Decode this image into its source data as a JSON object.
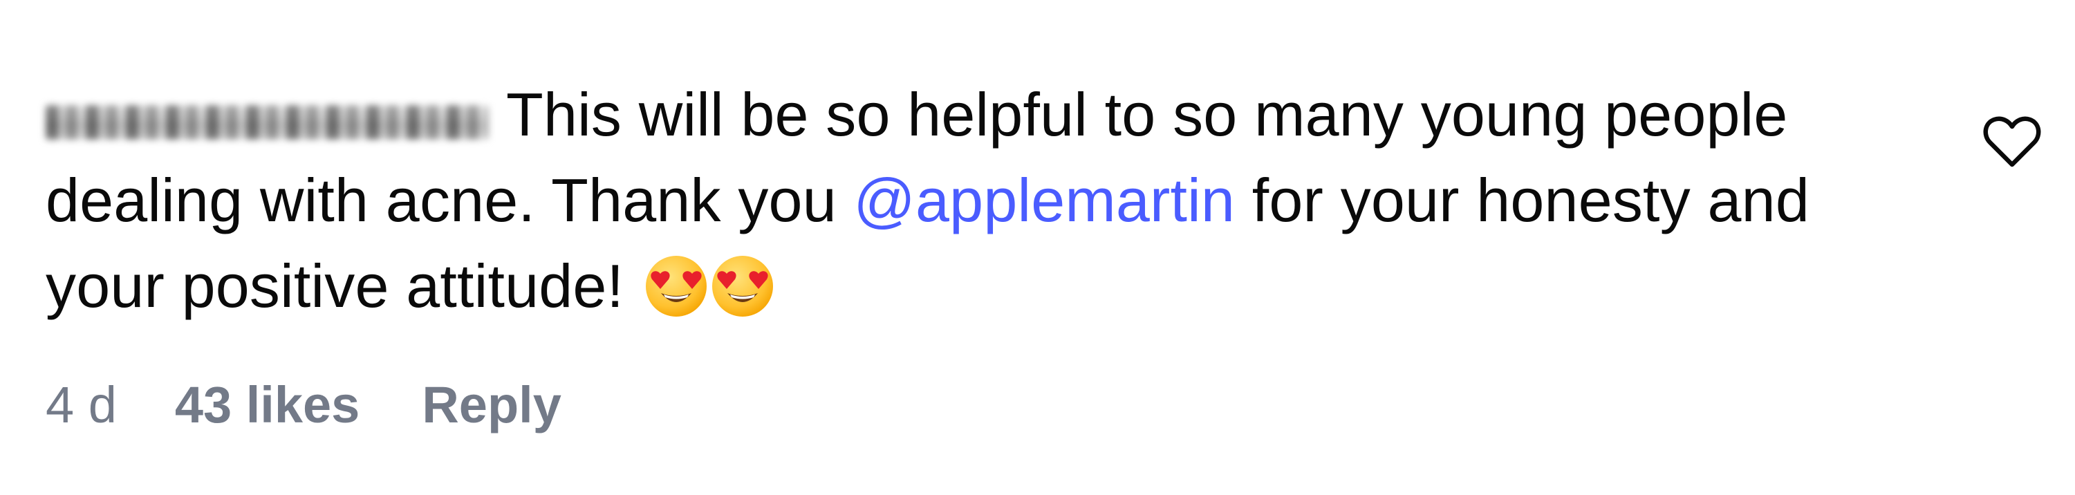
{
  "comment": {
    "username": "username",
    "text_before_mention": "This will be so helpful to so many young people dealing with acne. Thank you ",
    "mention": "@applemartin",
    "text_after_mention": " for your honesty and your positive attitude!",
    "emojis": [
      "heart-eyes",
      "heart-eyes"
    ],
    "time": "4 d",
    "likes": "43 likes",
    "reply_label": "Reply"
  },
  "colors": {
    "text": "#0a0a0a",
    "mention": "#4a5cff",
    "meta": "#737a88"
  },
  "icons": {
    "like": "heart-outline-icon",
    "emoji": "heart-eyes-emoji-icon"
  }
}
